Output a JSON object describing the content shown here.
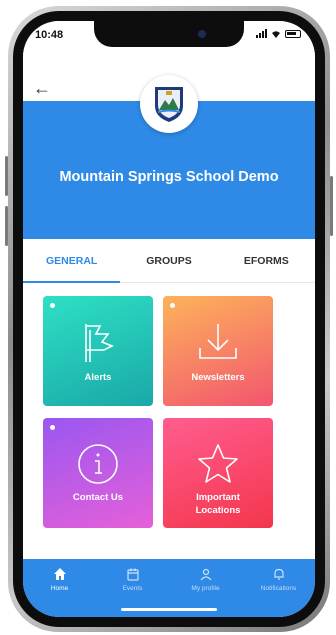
{
  "status_bar": {
    "time": "10:48"
  },
  "header": {
    "title": "Mountain Springs School Demo",
    "back_icon": "back-arrow-icon"
  },
  "tabs": [
    {
      "label": "GENERAL",
      "active": true
    },
    {
      "label": "GROUPS",
      "active": false
    },
    {
      "label": "EFORMS",
      "active": false
    }
  ],
  "tiles": [
    {
      "label": "Alerts",
      "icon": "flag-icon"
    },
    {
      "label": "Newsletters",
      "icon": "download-icon"
    },
    {
      "label": "Contact Us",
      "icon": "info-icon"
    },
    {
      "label": "Important Locations",
      "icon": "star-icon"
    }
  ],
  "bottom_nav": [
    {
      "label": "Home",
      "icon": "home-icon",
      "active": true
    },
    {
      "label": "Events",
      "icon": "calendar-icon",
      "active": false
    },
    {
      "label": "My profile",
      "icon": "profile-icon",
      "active": false
    },
    {
      "label": "Notifications",
      "icon": "bell-icon",
      "active": false
    }
  ],
  "colors": {
    "brand_blue": "#2e8ae6",
    "alerts_gradient": [
      "#2ee0c4",
      "#1aa8a8"
    ],
    "newsletters_gradient": [
      "#fdb35a",
      "#f2566f"
    ],
    "contact_gradient": [
      "#9a57f0",
      "#e560d9"
    ],
    "locations_gradient": [
      "#ff5d8f",
      "#f4364c"
    ]
  }
}
